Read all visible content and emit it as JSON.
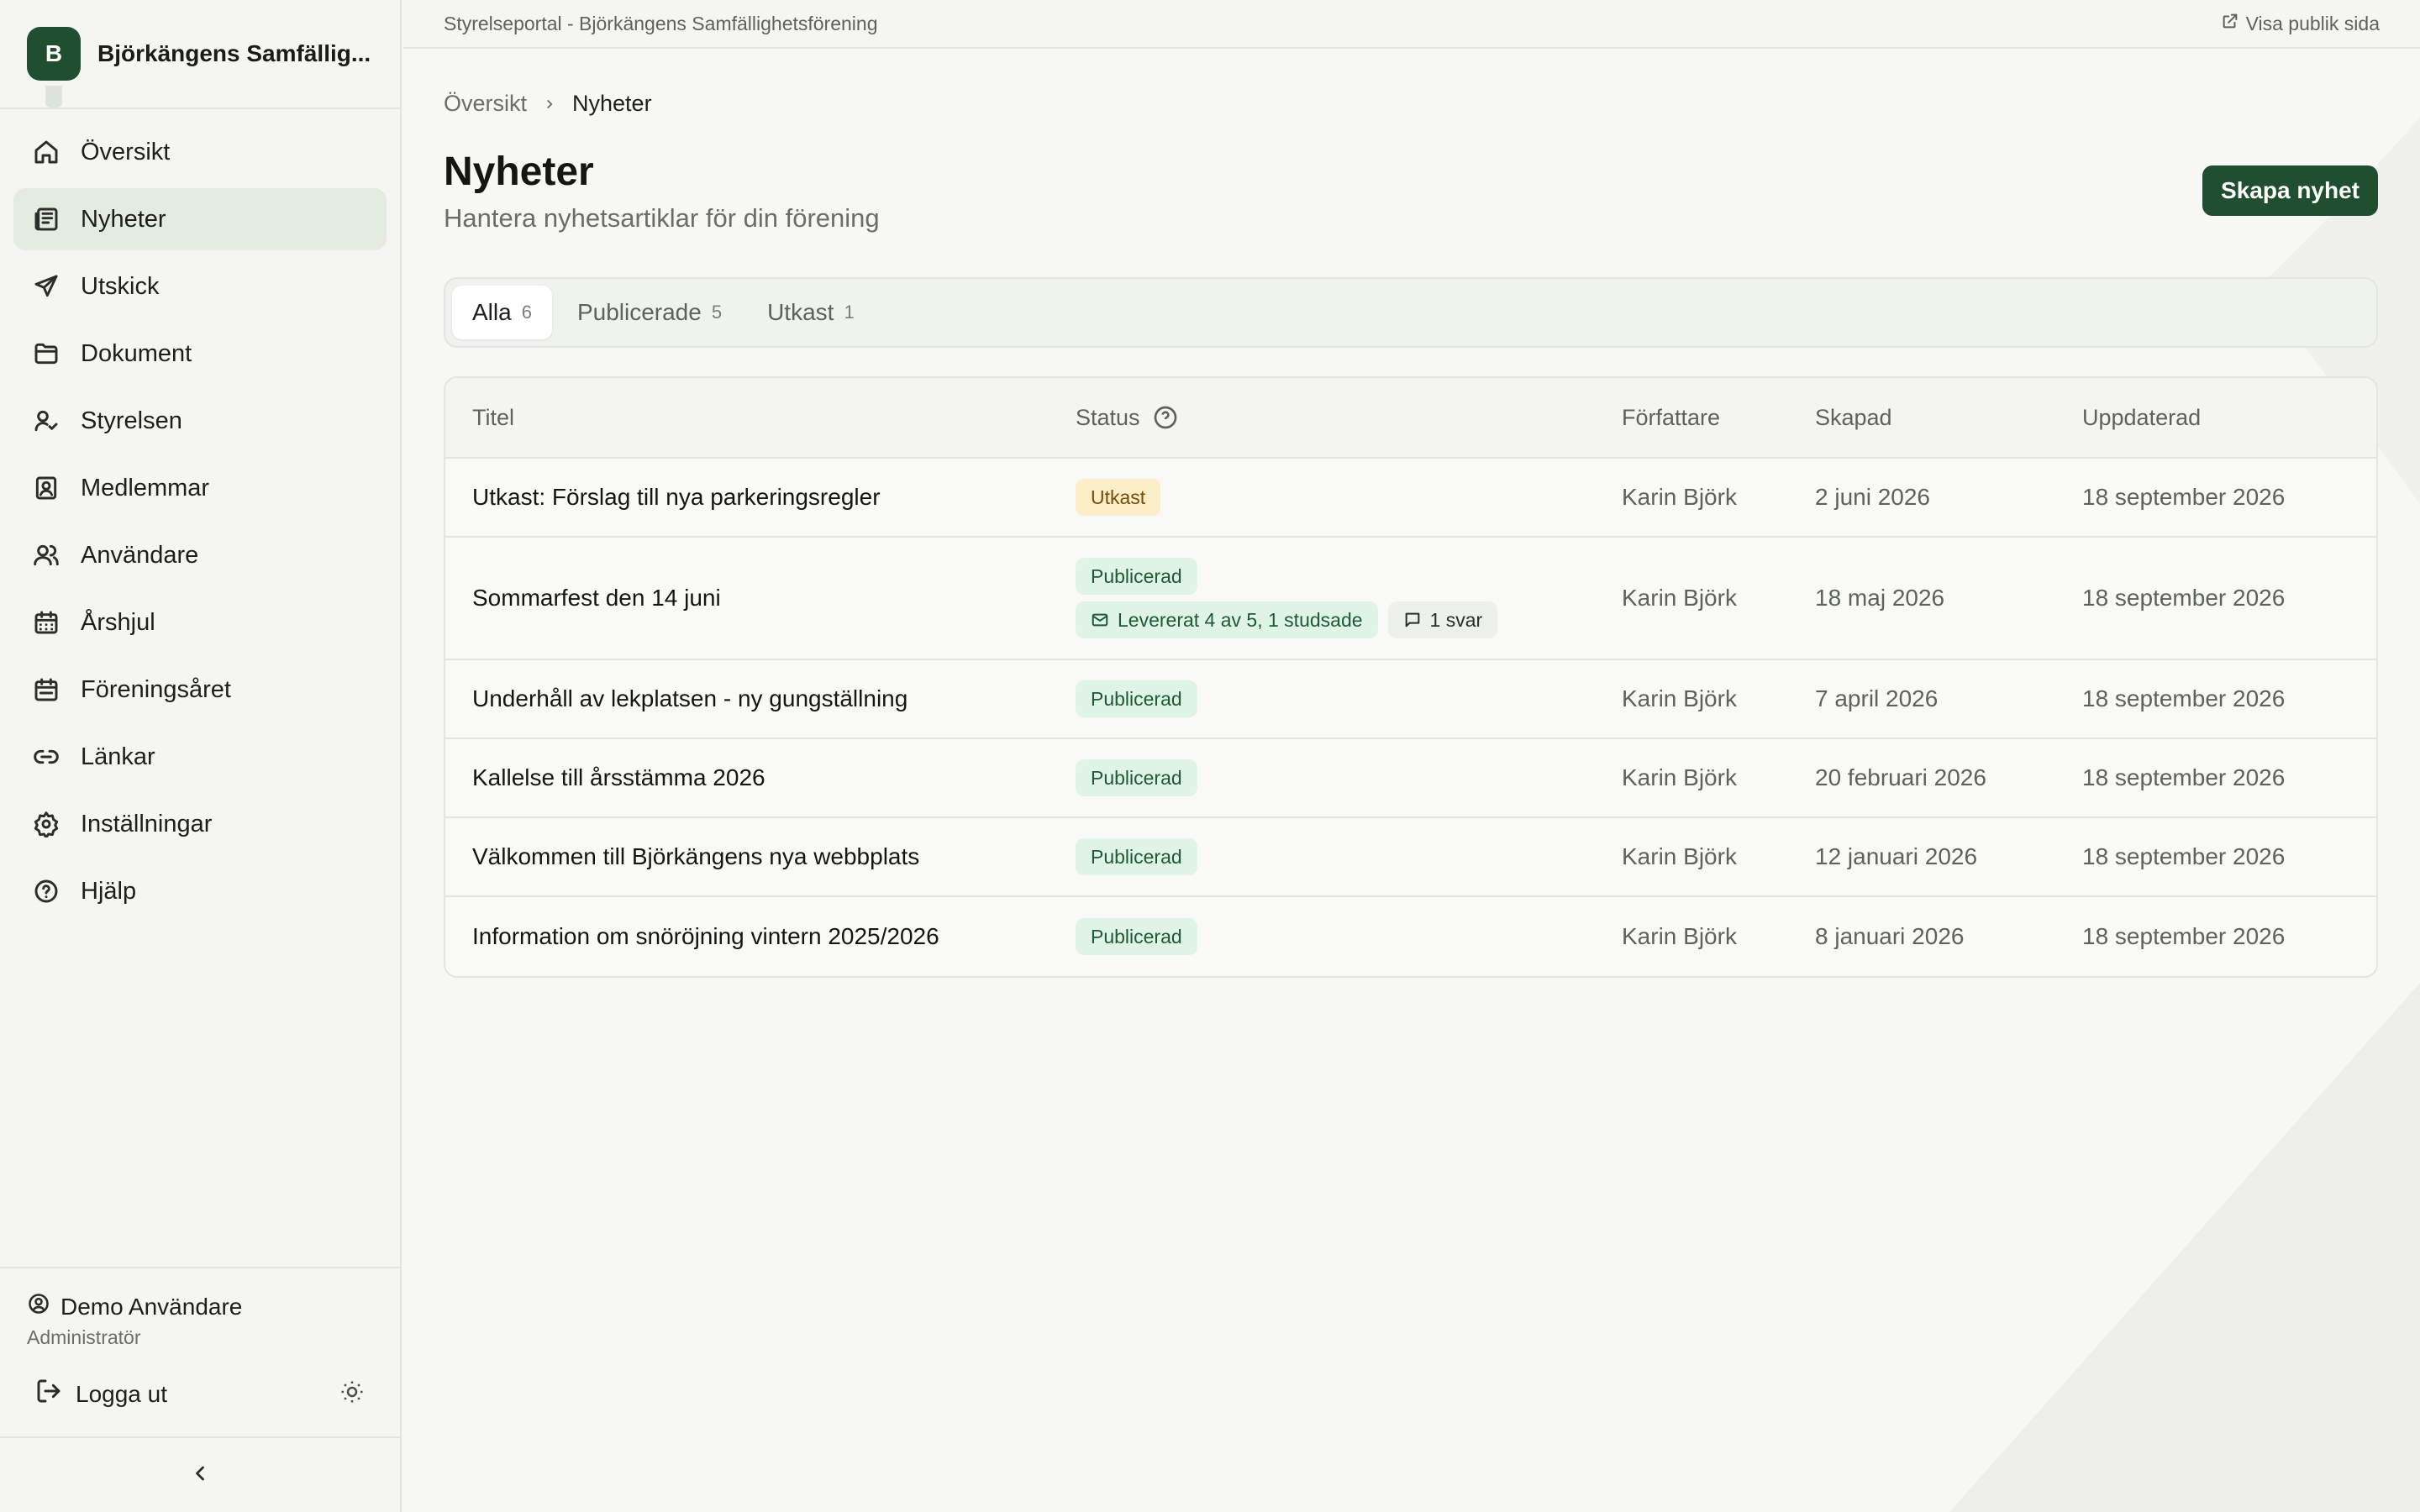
{
  "sidebar": {
    "brand_initial": "B",
    "brand_name": "Björkängens Samfällig...",
    "items": [
      {
        "label": "Översikt",
        "icon": "home-icon"
      },
      {
        "label": "Nyheter",
        "icon": "newspaper-icon",
        "active": true
      },
      {
        "label": "Utskick",
        "icon": "send-icon"
      },
      {
        "label": "Dokument",
        "icon": "folder-icon"
      },
      {
        "label": "Styrelsen",
        "icon": "user-check-icon"
      },
      {
        "label": "Medlemmar",
        "icon": "contact-book-icon"
      },
      {
        "label": "Användare",
        "icon": "users-icon"
      },
      {
        "label": "Årshjul",
        "icon": "calendar-grid-icon"
      },
      {
        "label": "Föreningsåret",
        "icon": "calendar-icon"
      },
      {
        "label": "Länkar",
        "icon": "link-icon"
      },
      {
        "label": "Inställningar",
        "icon": "gear-icon"
      },
      {
        "label": "Hjälp",
        "icon": "help-circle-icon"
      }
    ],
    "user_name": "Demo Användare",
    "user_role": "Administratör",
    "logout_label": "Logga ut"
  },
  "topbar": {
    "portal_title": "Styrelseportal - Björkängens Samfällighetsförening",
    "public_link": "Visa publik sida"
  },
  "breadcrumb": {
    "root": "Översikt",
    "current": "Nyheter"
  },
  "page": {
    "title": "Nyheter",
    "subtitle": "Hantera nyhetsartiklar för din förening",
    "create_button": "Skapa nyhet"
  },
  "tabs": [
    {
      "label": "Alla",
      "count": "6",
      "active": true
    },
    {
      "label": "Publicerade",
      "count": "5"
    },
    {
      "label": "Utkast",
      "count": "1"
    }
  ],
  "table": {
    "headers": {
      "title": "Titel",
      "status": "Status",
      "author": "Författare",
      "created": "Skapad",
      "updated": "Uppdaterad"
    },
    "rows": [
      {
        "title": "Utkast: Förslag till nya parkeringsregler",
        "status": "Utkast",
        "author": "Karin Björk",
        "created": "2 juni 2026",
        "updated": "18 september 2026"
      },
      {
        "title": "Sommarfest den 14 juni",
        "status": "Publicerad",
        "delivery": "Levererat 4 av 5, 1 studsade",
        "replies": "1 svar",
        "author": "Karin Björk",
        "created": "18 maj 2026",
        "updated": "18 september 2026"
      },
      {
        "title": "Underhåll av lekplatsen - ny gungställning",
        "status": "Publicerad",
        "author": "Karin Björk",
        "created": "7 april 2026",
        "updated": "18 september 2026"
      },
      {
        "title": "Kallelse till årsstämma 2026",
        "status": "Publicerad",
        "author": "Karin Björk",
        "created": "20 februari 2026",
        "updated": "18 september 2026"
      },
      {
        "title": "Välkommen till Björkängens nya webbplats",
        "status": "Publicerad",
        "author": "Karin Björk",
        "created": "12 januari 2026",
        "updated": "18 september 2026"
      },
      {
        "title": "Information om snöröjning vintern 2025/2026",
        "status": "Publicerad",
        "author": "Karin Björk",
        "created": "8 januari 2026",
        "updated": "18 september 2026"
      }
    ]
  },
  "colors": {
    "brand": "#1f4f2f",
    "draft_bg": "#fcefc8",
    "published_bg": "#dff3e6"
  }
}
